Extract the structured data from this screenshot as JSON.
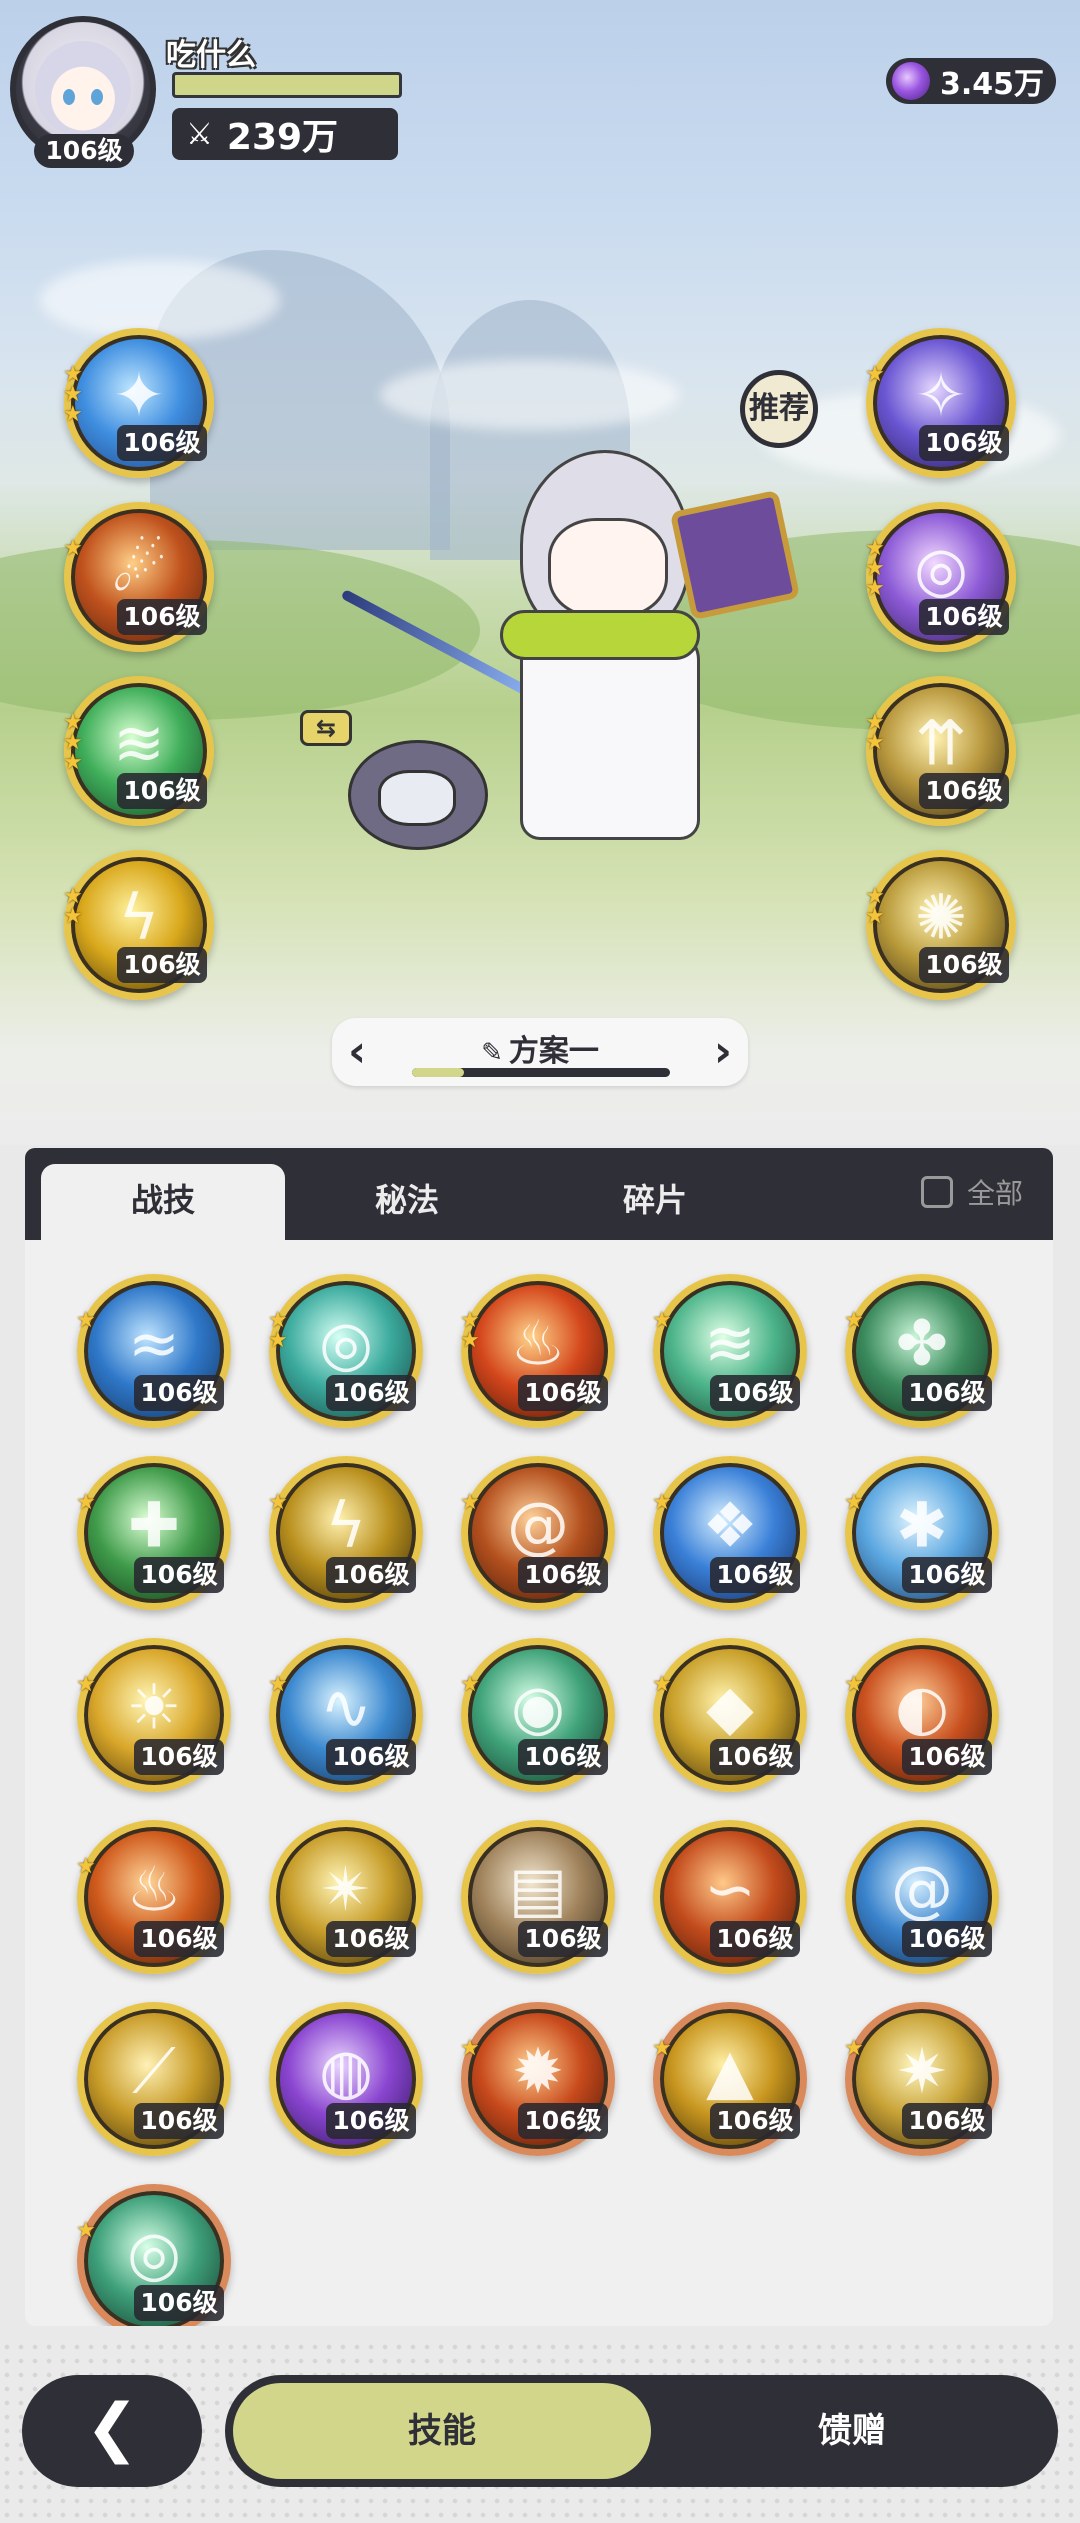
{
  "player": {
    "name": "吃什么",
    "level": "106级",
    "power": "239万",
    "power_icon": "crossed-swords-icon"
  },
  "currency": {
    "amount": "3.45万",
    "icon": "purple-gem-icon"
  },
  "recommend_label": "推荐",
  "equipped": {
    "left": [
      {
        "name": "ice-burst-skill-icon",
        "level": "106级",
        "stars": 3,
        "colors": [
          "#bfe6ff",
          "#3f8ee0",
          "#1d3f7c"
        ],
        "glyph": "✦"
      },
      {
        "name": "fire-meteor-skill-icon",
        "level": "106级",
        "stars": 1,
        "colors": [
          "#ffcf87",
          "#c0521d",
          "#4a1a0c"
        ],
        "glyph": "☄"
      },
      {
        "name": "wind-slash-skill-icon",
        "level": "106级",
        "stars": 3,
        "colors": [
          "#d8ffd0",
          "#3fae5a",
          "#123a20"
        ],
        "glyph": "≋"
      },
      {
        "name": "thunder-orb-skill-icon",
        "level": "106级",
        "stars": 2,
        "colors": [
          "#fff2a0",
          "#d9a81c",
          "#3b2c06"
        ],
        "glyph": "ϟ"
      }
    ],
    "right": [
      {
        "name": "arcane-vortex-skill-icon",
        "level": "106级",
        "stars": 1,
        "colors": [
          "#e5d7ff",
          "#6a56d2",
          "#22194f"
        ],
        "glyph": "✧"
      },
      {
        "name": "arcane-clock-skill-icon",
        "level": "106级",
        "stars": 3,
        "colors": [
          "#f2d9ff",
          "#8c5ad6",
          "#2a1a4f"
        ],
        "glyph": "◎"
      },
      {
        "name": "holy-spears-skill-icon",
        "level": "106级",
        "stars": 2,
        "colors": [
          "#fff3b4",
          "#b9983e",
          "#2c240e"
        ],
        "glyph": "⇈"
      },
      {
        "name": "holy-burst-skill-icon",
        "level": "106级",
        "stars": 2,
        "colors": [
          "#fff3b4",
          "#b99a3a",
          "#2c2410"
        ],
        "glyph": "✺"
      }
    ]
  },
  "loadout": {
    "title": "方案一",
    "edit_icon": "pencil-icon",
    "progress": 0.2
  },
  "tabs": [
    "战技",
    "秘法",
    "碎片"
  ],
  "filter_label": "全部",
  "skills": [
    {
      "name": "water-splash-skill-icon",
      "level": "106级",
      "stars": 1,
      "colors": [
        "#bfe4ff",
        "#2f78c9",
        "#0f2a52"
      ],
      "border": "gold",
      "glyph": "≈"
    },
    {
      "name": "water-vortex-skill-icon",
      "level": "106级",
      "stars": 2,
      "colors": [
        "#d5fff4",
        "#3cab9e",
        "#103a38"
      ],
      "border": "gold",
      "glyph": "◎"
    },
    {
      "name": "flame-skill-icon",
      "level": "106级",
      "stars": 2,
      "colors": [
        "#ffd38a",
        "#d4471c",
        "#3a0e06"
      ],
      "border": "gold",
      "glyph": "♨"
    },
    {
      "name": "wind-blade-skill-icon",
      "level": "106级",
      "stars": 1,
      "colors": [
        "#dfffe6",
        "#4cb48a",
        "#123a2a"
      ],
      "border": "gold",
      "glyph": "≋"
    },
    {
      "name": "thorn-vine-skill-icon",
      "level": "106级",
      "stars": 1,
      "colors": [
        "#c9f5d8",
        "#3a8a5c",
        "#0f2a1c"
      ],
      "border": "gold",
      "glyph": "✤"
    },
    {
      "name": "healing-cross-skill-icon",
      "level": "106级",
      "stars": 1,
      "colors": [
        "#dcffd5",
        "#3f9b4a",
        "#0f2d14"
      ],
      "border": "gold",
      "glyph": "✚"
    },
    {
      "name": "lightning-skill-icon",
      "level": "106级",
      "stars": 1,
      "colors": [
        "#fff1b0",
        "#b9901e",
        "#2a1f05"
      ],
      "border": "gold",
      "glyph": "ϟ"
    },
    {
      "name": "fire-swirl-skill-icon",
      "level": "106级",
      "stars": 1,
      "colors": [
        "#ffd19a",
        "#b3501e",
        "#3a1206"
      ],
      "border": "gold",
      "glyph": "@"
    },
    {
      "name": "ice-shard-skill-icon",
      "level": "106级",
      "stars": 1,
      "colors": [
        "#d6efff",
        "#3a80d8",
        "#0f2250"
      ],
      "border": "gold",
      "glyph": "❖"
    },
    {
      "name": "ice-crystal-skill-icon",
      "level": "106级",
      "stars": 1,
      "colors": [
        "#e2f5ff",
        "#5aa6e0",
        "#142b50"
      ],
      "border": "gold",
      "glyph": "✱"
    },
    {
      "name": "sun-burst-skill-icon",
      "level": "106级",
      "stars": 1,
      "colors": [
        "#fff6b8",
        "#d9a72a",
        "#3a2a06"
      ],
      "border": "gold",
      "glyph": "☀"
    },
    {
      "name": "tidal-wave-skill-icon",
      "level": "106级",
      "stars": 1,
      "colors": [
        "#d9f3ff",
        "#3b88cf",
        "#0f2645"
      ],
      "border": "gold",
      "glyph": "∿"
    },
    {
      "name": "wind-orb-skill-icon",
      "level": "106级",
      "stars": 1,
      "colors": [
        "#d8ffe8",
        "#40a37a",
        "#0f2c20"
      ],
      "border": "gold",
      "glyph": "◉"
    },
    {
      "name": "holy-diamond-skill-icon",
      "level": "106级",
      "stars": 1,
      "colors": [
        "#fff3b0",
        "#c9a02a",
        "#2e2306"
      ],
      "border": "gold",
      "glyph": "◆"
    },
    {
      "name": "fire-eye-skill-icon",
      "level": "106级",
      "stars": 1,
      "colors": [
        "#ffd09a",
        "#c9501f",
        "#3a1206"
      ],
      "border": "gold",
      "glyph": "◐"
    },
    {
      "name": "fire-storm-skill-icon",
      "level": "106级",
      "stars": 1,
      "colors": [
        "#ffd59a",
        "#cf5a1c",
        "#3a1206"
      ],
      "border": "gold",
      "glyph": "♨"
    },
    {
      "name": "light-flash-skill-icon",
      "level": "106级",
      "stars": 0,
      "colors": [
        "#fff5b8",
        "#c79d2a",
        "#2f2406"
      ],
      "border": "gold",
      "glyph": "✴"
    },
    {
      "name": "card-throw-skill-icon",
      "level": "106级",
      "stars": 0,
      "colors": [
        "#f2e6cf",
        "#a0835c",
        "#2a2014"
      ],
      "border": "gold",
      "glyph": "▤"
    },
    {
      "name": "lava-wave-skill-icon",
      "level": "106级",
      "stars": 0,
      "colors": [
        "#ffc98a",
        "#c34b1c",
        "#3a1206"
      ],
      "border": "gold",
      "glyph": "∽"
    },
    {
      "name": "whirlpool-skill-icon",
      "level": "106级",
      "stars": 0,
      "colors": [
        "#d5efff",
        "#3a83cc",
        "#0f2446"
      ],
      "border": "gold",
      "glyph": "@"
    },
    {
      "name": "golden-blade-skill-icon",
      "level": "106级",
      "stars": 0,
      "colors": [
        "#fff1b5",
        "#c89b28",
        "#2f2306"
      ],
      "border": "gold",
      "glyph": "⟋"
    },
    {
      "name": "void-sphere-skill-icon",
      "level": "106级",
      "stars": 0,
      "colors": [
        "#ead6ff",
        "#8a45d0",
        "#21104a"
      ],
      "border": "gold",
      "glyph": "◍"
    },
    {
      "name": "explosion-skill-icon",
      "level": "106级",
      "stars": 1,
      "colors": [
        "#ffcf8f",
        "#c84a1c",
        "#3a1006"
      ],
      "border": "copper",
      "glyph": "✹"
    },
    {
      "name": "golden-spike-skill-icon",
      "level": "106级",
      "stars": 1,
      "colors": [
        "#fff0a8",
        "#c8961f",
        "#2f2105"
      ],
      "border": "copper",
      "glyph": "▲"
    },
    {
      "name": "radiant-star-skill-icon",
      "level": "106级",
      "stars": 1,
      "colors": [
        "#fff6c0",
        "#c8a236",
        "#2e2408"
      ],
      "border": "copper",
      "glyph": "✷"
    },
    {
      "name": "green-tornado-skill-icon",
      "level": "106级",
      "stars": 1,
      "colors": [
        "#d8ffe8",
        "#3ea07a",
        "#0f2c20"
      ],
      "border": "copper",
      "glyph": "◎"
    }
  ],
  "bottom_nav": {
    "back_icon": "chevron-left-icon",
    "tabs": [
      "技能",
      "馈赠"
    ]
  }
}
